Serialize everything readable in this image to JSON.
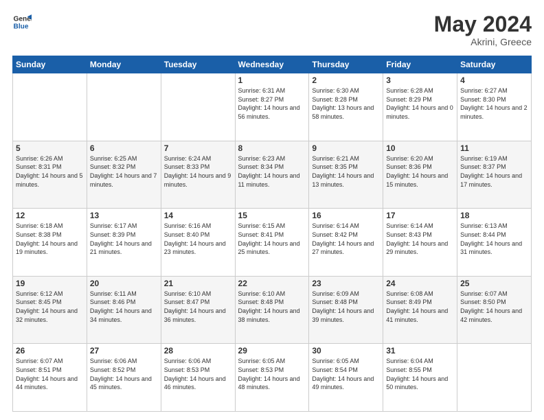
{
  "header": {
    "logo_general": "General",
    "logo_blue": "Blue",
    "month_year": "May 2024",
    "location": "Akrini, Greece"
  },
  "weekdays": [
    "Sunday",
    "Monday",
    "Tuesday",
    "Wednesday",
    "Thursday",
    "Friday",
    "Saturday"
  ],
  "weeks": [
    [
      {
        "day": "",
        "sunrise": "",
        "sunset": "",
        "daylight": ""
      },
      {
        "day": "",
        "sunrise": "",
        "sunset": "",
        "daylight": ""
      },
      {
        "day": "",
        "sunrise": "",
        "sunset": "",
        "daylight": ""
      },
      {
        "day": "1",
        "sunrise": "Sunrise: 6:31 AM",
        "sunset": "Sunset: 8:27 PM",
        "daylight": "Daylight: 14 hours and 56 minutes."
      },
      {
        "day": "2",
        "sunrise": "Sunrise: 6:30 AM",
        "sunset": "Sunset: 8:28 PM",
        "daylight": "Daylight: 13 hours and 58 minutes."
      },
      {
        "day": "3",
        "sunrise": "Sunrise: 6:28 AM",
        "sunset": "Sunset: 8:29 PM",
        "daylight": "Daylight: 14 hours and 0 minutes."
      },
      {
        "day": "4",
        "sunrise": "Sunrise: 6:27 AM",
        "sunset": "Sunset: 8:30 PM",
        "daylight": "Daylight: 14 hours and 2 minutes."
      }
    ],
    [
      {
        "day": "5",
        "sunrise": "Sunrise: 6:26 AM",
        "sunset": "Sunset: 8:31 PM",
        "daylight": "Daylight: 14 hours and 5 minutes."
      },
      {
        "day": "6",
        "sunrise": "Sunrise: 6:25 AM",
        "sunset": "Sunset: 8:32 PM",
        "daylight": "Daylight: 14 hours and 7 minutes."
      },
      {
        "day": "7",
        "sunrise": "Sunrise: 6:24 AM",
        "sunset": "Sunset: 8:33 PM",
        "daylight": "Daylight: 14 hours and 9 minutes."
      },
      {
        "day": "8",
        "sunrise": "Sunrise: 6:23 AM",
        "sunset": "Sunset: 8:34 PM",
        "daylight": "Daylight: 14 hours and 11 minutes."
      },
      {
        "day": "9",
        "sunrise": "Sunrise: 6:21 AM",
        "sunset": "Sunset: 8:35 PM",
        "daylight": "Daylight: 14 hours and 13 minutes."
      },
      {
        "day": "10",
        "sunrise": "Sunrise: 6:20 AM",
        "sunset": "Sunset: 8:36 PM",
        "daylight": "Daylight: 14 hours and 15 minutes."
      },
      {
        "day": "11",
        "sunrise": "Sunrise: 6:19 AM",
        "sunset": "Sunset: 8:37 PM",
        "daylight": "Daylight: 14 hours and 17 minutes."
      }
    ],
    [
      {
        "day": "12",
        "sunrise": "Sunrise: 6:18 AM",
        "sunset": "Sunset: 8:38 PM",
        "daylight": "Daylight: 14 hours and 19 minutes."
      },
      {
        "day": "13",
        "sunrise": "Sunrise: 6:17 AM",
        "sunset": "Sunset: 8:39 PM",
        "daylight": "Daylight: 14 hours and 21 minutes."
      },
      {
        "day": "14",
        "sunrise": "Sunrise: 6:16 AM",
        "sunset": "Sunset: 8:40 PM",
        "daylight": "Daylight: 14 hours and 23 minutes."
      },
      {
        "day": "15",
        "sunrise": "Sunrise: 6:15 AM",
        "sunset": "Sunset: 8:41 PM",
        "daylight": "Daylight: 14 hours and 25 minutes."
      },
      {
        "day": "16",
        "sunrise": "Sunrise: 6:14 AM",
        "sunset": "Sunset: 8:42 PM",
        "daylight": "Daylight: 14 hours and 27 minutes."
      },
      {
        "day": "17",
        "sunrise": "Sunrise: 6:14 AM",
        "sunset": "Sunset: 8:43 PM",
        "daylight": "Daylight: 14 hours and 29 minutes."
      },
      {
        "day": "18",
        "sunrise": "Sunrise: 6:13 AM",
        "sunset": "Sunset: 8:44 PM",
        "daylight": "Daylight: 14 hours and 31 minutes."
      }
    ],
    [
      {
        "day": "19",
        "sunrise": "Sunrise: 6:12 AM",
        "sunset": "Sunset: 8:45 PM",
        "daylight": "Daylight: 14 hours and 32 minutes."
      },
      {
        "day": "20",
        "sunrise": "Sunrise: 6:11 AM",
        "sunset": "Sunset: 8:46 PM",
        "daylight": "Daylight: 14 hours and 34 minutes."
      },
      {
        "day": "21",
        "sunrise": "Sunrise: 6:10 AM",
        "sunset": "Sunset: 8:47 PM",
        "daylight": "Daylight: 14 hours and 36 minutes."
      },
      {
        "day": "22",
        "sunrise": "Sunrise: 6:10 AM",
        "sunset": "Sunset: 8:48 PM",
        "daylight": "Daylight: 14 hours and 38 minutes."
      },
      {
        "day": "23",
        "sunrise": "Sunrise: 6:09 AM",
        "sunset": "Sunset: 8:48 PM",
        "daylight": "Daylight: 14 hours and 39 minutes."
      },
      {
        "day": "24",
        "sunrise": "Sunrise: 6:08 AM",
        "sunset": "Sunset: 8:49 PM",
        "daylight": "Daylight: 14 hours and 41 minutes."
      },
      {
        "day": "25",
        "sunrise": "Sunrise: 6:07 AM",
        "sunset": "Sunset: 8:50 PM",
        "daylight": "Daylight: 14 hours and 42 minutes."
      }
    ],
    [
      {
        "day": "26",
        "sunrise": "Sunrise: 6:07 AM",
        "sunset": "Sunset: 8:51 PM",
        "daylight": "Daylight: 14 hours and 44 minutes."
      },
      {
        "day": "27",
        "sunrise": "Sunrise: 6:06 AM",
        "sunset": "Sunset: 8:52 PM",
        "daylight": "Daylight: 14 hours and 45 minutes."
      },
      {
        "day": "28",
        "sunrise": "Sunrise: 6:06 AM",
        "sunset": "Sunset: 8:53 PM",
        "daylight": "Daylight: 14 hours and 46 minutes."
      },
      {
        "day": "29",
        "sunrise": "Sunrise: 6:05 AM",
        "sunset": "Sunset: 8:53 PM",
        "daylight": "Daylight: 14 hours and 48 minutes."
      },
      {
        "day": "30",
        "sunrise": "Sunrise: 6:05 AM",
        "sunset": "Sunset: 8:54 PM",
        "daylight": "Daylight: 14 hours and 49 minutes."
      },
      {
        "day": "31",
        "sunrise": "Sunrise: 6:04 AM",
        "sunset": "Sunset: 8:55 PM",
        "daylight": "Daylight: 14 hours and 50 minutes."
      },
      {
        "day": "",
        "sunrise": "",
        "sunset": "",
        "daylight": ""
      }
    ]
  ]
}
